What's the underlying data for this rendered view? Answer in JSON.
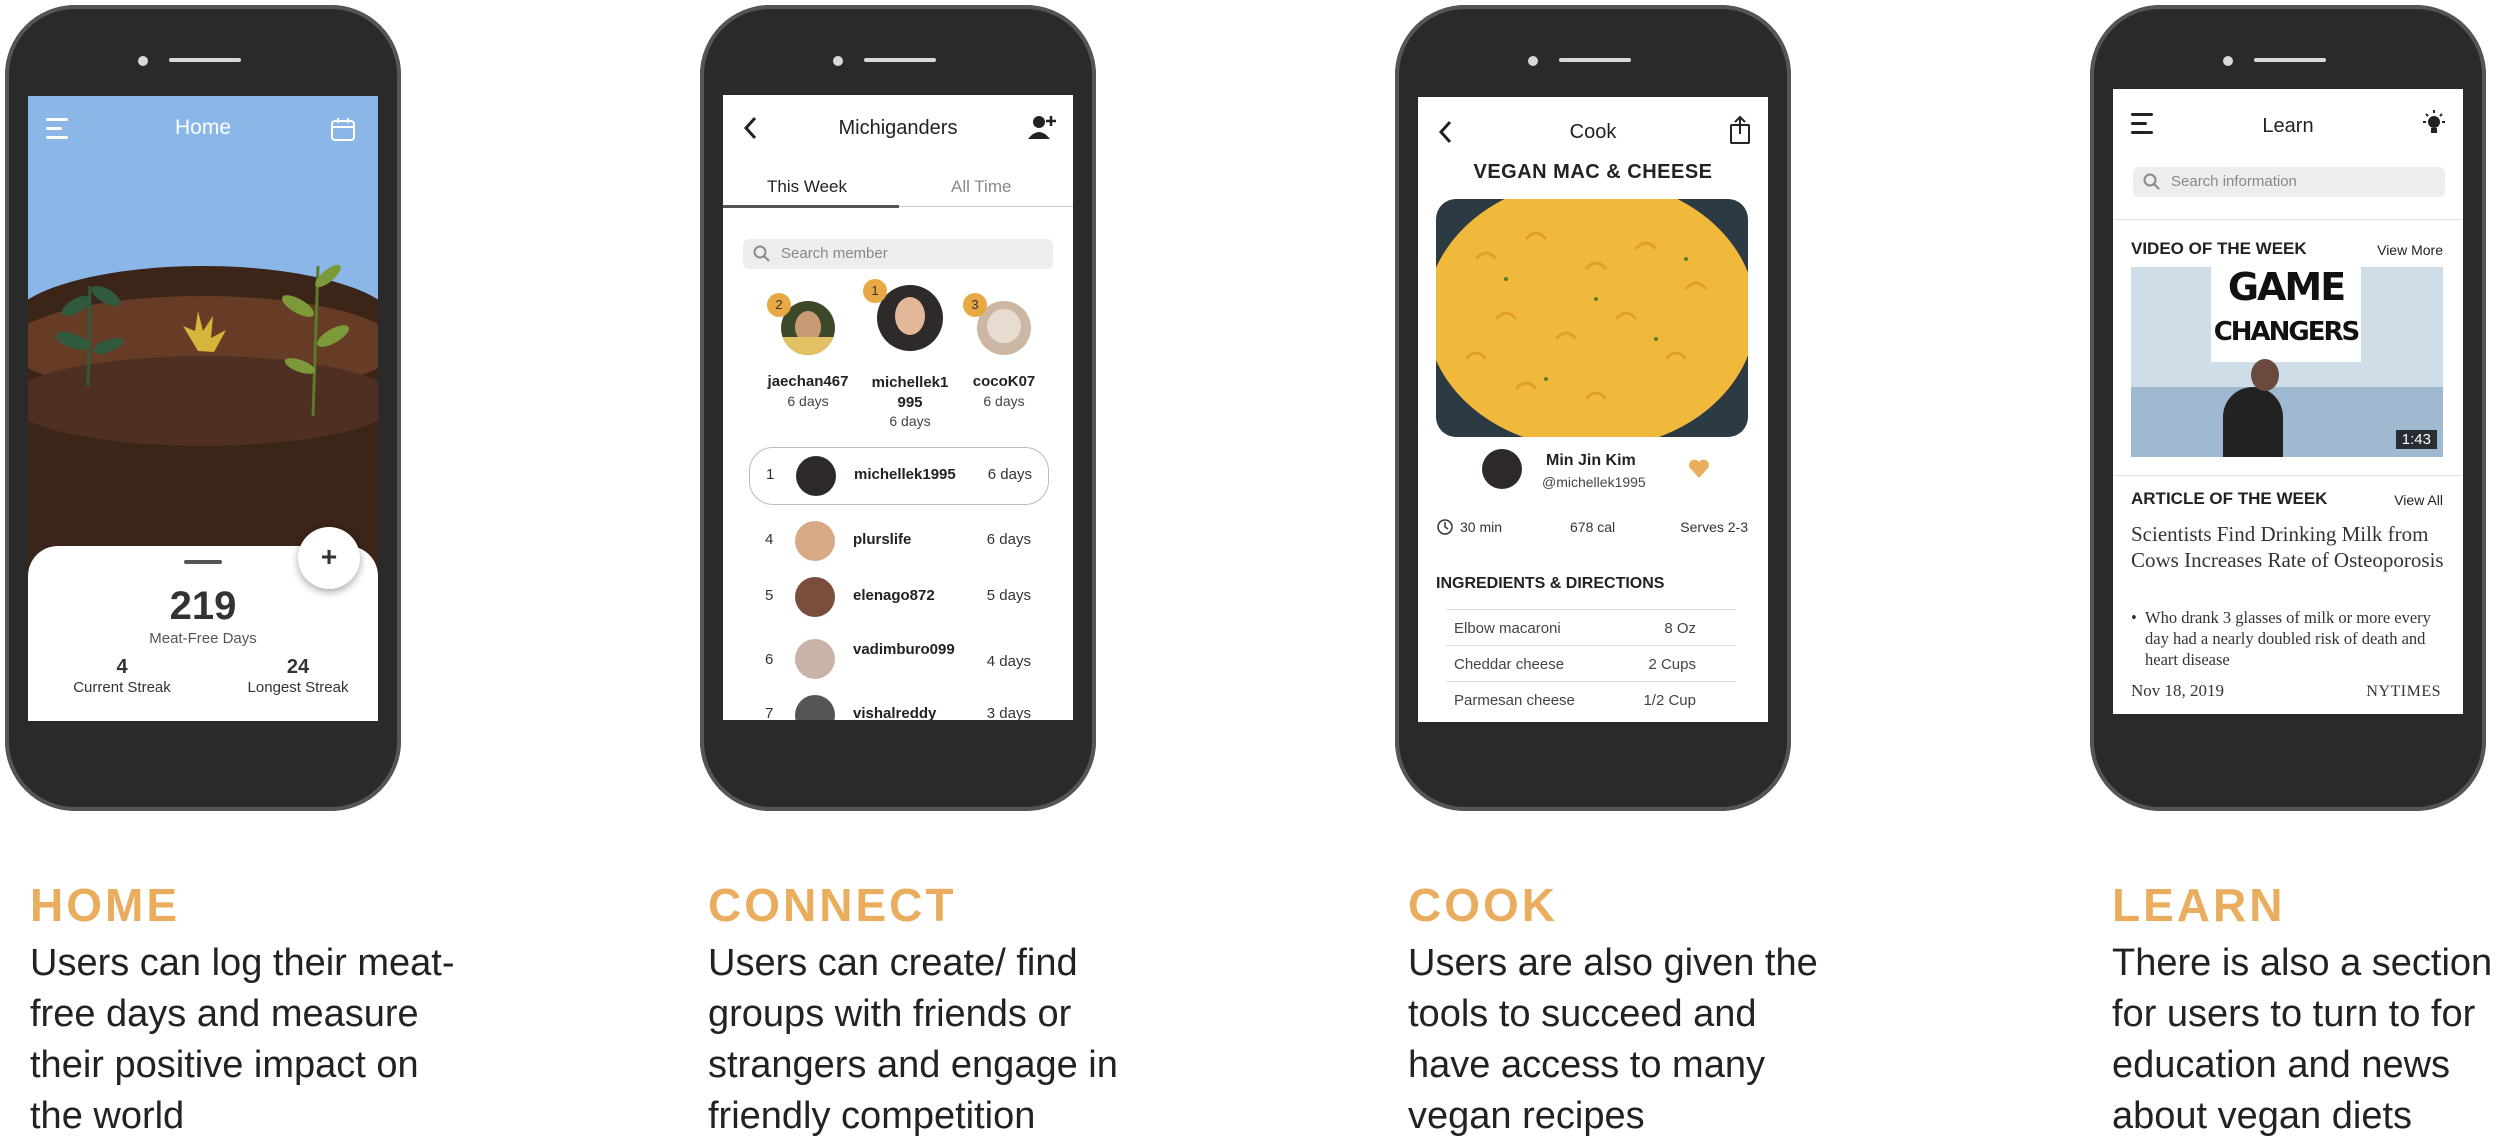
{
  "home": {
    "title": "Home",
    "meat_free_days": "219",
    "meat_free_label": "Meat-Free Days",
    "current_streak": "4",
    "current_streak_label": "Current Streak",
    "longest_streak": "24",
    "longest_streak_label": "Longest Streak",
    "add_label": "+",
    "caption_title": "HOME",
    "caption_body": "Users can log their meat-free days and measure their positive impact on the world"
  },
  "connect": {
    "title": "Michiganders",
    "tab_week": "This Week",
    "tab_all": "All Time",
    "search_placeholder": "Search member",
    "podium": [
      {
        "rank": "2",
        "name": "jaechan467",
        "days": "6 days"
      },
      {
        "rank": "1",
        "name": "michellek1\n995",
        "days": "6 days"
      },
      {
        "rank": "3",
        "name": "cocoK07",
        "days": "6 days"
      }
    ],
    "rows": [
      {
        "rank": "1",
        "name": "michellek1995",
        "days": "6 days"
      },
      {
        "rank": "4",
        "name": "plurslife",
        "days": "6 days"
      },
      {
        "rank": "5",
        "name": "elenago872",
        "days": "5 days"
      },
      {
        "rank": "6",
        "name": "vadimburo099",
        "days": "4 days"
      },
      {
        "rank": "7",
        "name": "vishalreddy",
        "days": "3 days"
      }
    ],
    "caption_title": "CONNECT",
    "caption_body": "Users can create/ find groups with friends or strangers and engage in friendly competition"
  },
  "cook": {
    "title": "Cook",
    "recipe": "VEGAN MAC & CHEESE",
    "author_name": "Min Jin Kim",
    "author_handle": "@michellek1995",
    "time": "30 min",
    "calories": "678 cal",
    "serves": "Serves 2-3",
    "section": "INGREDIENTS & DIRECTIONS",
    "ingredients": [
      {
        "name": "Elbow macaroni",
        "qty": "8 Oz"
      },
      {
        "name": "Cheddar cheese",
        "qty": "2 Cups"
      },
      {
        "name": "Parmesan cheese",
        "qty": "1/2 Cup"
      }
    ],
    "caption_title": "COOK",
    "caption_body": "Users are also given the tools to succeed and have access to many vegan recipes"
  },
  "learn": {
    "title": "Learn",
    "search_placeholder": "Search information",
    "video_heading": "VIDEO OF THE WEEK",
    "video_more": "View More",
    "video_title_1": "GAME",
    "video_title_2": "CHANGERS",
    "video_duration": "1:43",
    "article_heading": "ARTICLE OF THE WEEK",
    "article_more": "View All",
    "article_title": "Scientists Find Drinking Milk from Cows Increases Rate of Osteoporosis",
    "article_bullet": "Who drank 3 glasses of milk or more every day had a nearly doubled risk of death and heart disease",
    "article_date": "Nov 18, 2019",
    "article_source": "NYTIMES",
    "caption_title": "LEARN",
    "caption_body": "There is also a section for users to turn to for education and news about vegan diets"
  },
  "colors": {
    "accent": "#e9ad5d",
    "sky": "#8ab7e8",
    "soil": "#3b2418",
    "phone": "#2b2a2b"
  }
}
